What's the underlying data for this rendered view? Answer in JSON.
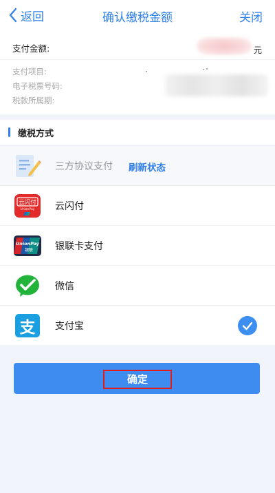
{
  "header": {
    "back_label": "返回",
    "title": "确认缴税金额",
    "close_label": "关闭"
  },
  "payment_info": {
    "amount_label": "支付金额:",
    "amount_unit": "元",
    "item_label": "支付项目:",
    "ticket_label": "电子税票号码:",
    "period_label": "税款所属期:"
  },
  "method_section": {
    "title": "缴税方式"
  },
  "methods": [
    {
      "label": "三方协议支付",
      "action": "刷新状态"
    },
    {
      "label": "云闪付",
      "icon_text_top": "云闪付",
      "icon_text_bottom": "UnionPay"
    },
    {
      "label": "银联卡支付",
      "icon_text_top": "UnionPay",
      "icon_text_bottom": "银联"
    },
    {
      "label": "微信"
    },
    {
      "label": "支付宝",
      "icon_text": "支"
    }
  ],
  "confirm_label": "确定",
  "colors": {
    "accent": "#2f80ed",
    "button": "#3e8cf0",
    "highlight_frame": "#e21d1d",
    "page_bg": "#f1f5fb"
  }
}
